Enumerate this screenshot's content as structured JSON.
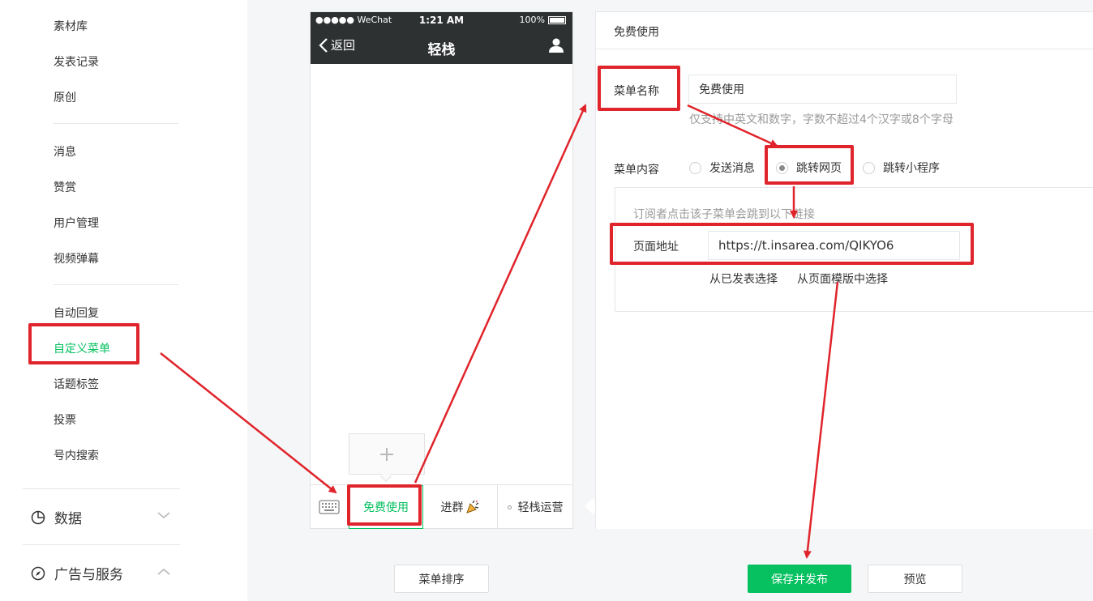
{
  "sidebar": {
    "items_group1": [
      "素材库",
      "发表记录",
      "原创"
    ],
    "items_group2": [
      "消息",
      "赞赏",
      "用户管理",
      "视频弹幕"
    ],
    "items_group3": [
      "自动回复",
      "自定义菜单",
      "话题标签",
      "投票",
      "号内搜索"
    ],
    "active_item": "自定义菜单",
    "groups": [
      {
        "label": "数据",
        "icon": "pie-chart-icon",
        "expanded": false
      },
      {
        "label": "广告与服务",
        "icon": "compass-icon",
        "expanded": true
      }
    ]
  },
  "phone": {
    "status": {
      "carrier": "●●●●● WeChat",
      "time": "1:21 AM",
      "battery": "100%"
    },
    "back_label": "返回",
    "title": "轻栈",
    "menu": [
      "免费使用",
      "进群",
      "轻栈运营"
    ],
    "menu2_icon": "party-popper-icon"
  },
  "editor": {
    "title": "免费使用",
    "menu_name_label": "菜单名称",
    "menu_name_value": "免费使用",
    "menu_name_hint": "仅支持中英文和数字，字数不超过4个汉字或8个字母",
    "menu_content_label": "菜单内容",
    "options": [
      "发送消息",
      "跳转网页",
      "跳转小程序"
    ],
    "selected_option": "跳转网页",
    "link_desc": "订阅者点击该子菜单会跳到以下链接",
    "page_url_label": "页面地址",
    "page_url_value": "https://t.insarea.com/QIKYO6",
    "pick_published": "从已发表选择",
    "pick_template": "从页面模版中选择"
  },
  "buttons": {
    "sort": "菜单排序",
    "save": "保存并发布",
    "preview": "预览"
  },
  "colors": {
    "accent": "#07c160",
    "annotation": "#e0242b",
    "header": "#2e3132"
  }
}
